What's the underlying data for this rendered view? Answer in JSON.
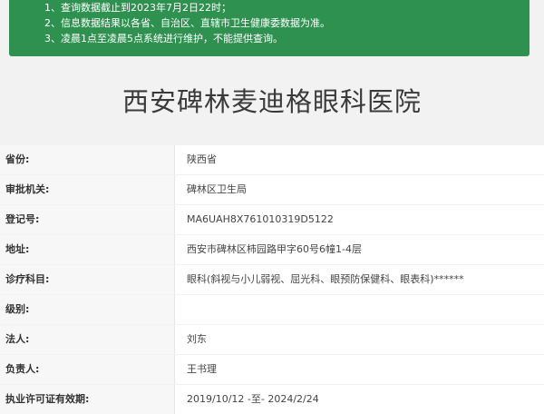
{
  "notice": {
    "lines": [
      "1、查询数据截止到2023年7月2日22时；",
      "2、信息数据结果以各省、自治区、直辖市卫生健康委数据为准。",
      "3、凌晨1点至凌晨5点系统进行维护，不能提供查询。"
    ],
    "bg_color": "#2e9150"
  },
  "hospital": {
    "name": "西安碑林麦迪格眼科医院"
  },
  "details": [
    {
      "label": "省份:",
      "value": "陕西省"
    },
    {
      "label": "审批机关:",
      "value": "碑林区卫生局"
    },
    {
      "label": "登记号:",
      "value": "MA6UAH8X761010319D5122"
    },
    {
      "label": "地址:",
      "value": "西安市碑林区柿园路甲字60号6幢1-4层"
    },
    {
      "label": "诊疗科目:",
      "value": "眼科(斜视与小儿弱视、屈光科、眼预防保健科、眼表科)******"
    },
    {
      "label": "级别:",
      "value": ""
    },
    {
      "label": "法人:",
      "value": "刘东"
    },
    {
      "label": "负责人:",
      "value": "王书理"
    },
    {
      "label": "执业许可证有效期:",
      "value": "2019/10/12 -至- 2024/2/24"
    }
  ]
}
